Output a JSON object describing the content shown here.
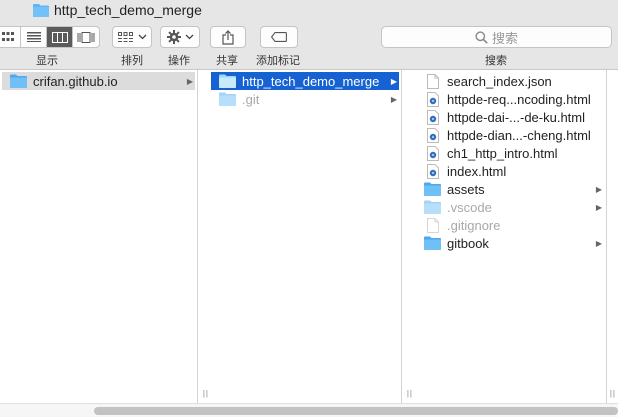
{
  "window": {
    "title": "http_tech_demo_merge"
  },
  "toolbar": {
    "view_label": "显示",
    "arrange_label": "排列",
    "action_label": "操作",
    "share_label": "共享",
    "tags_label": "添加标记",
    "search_placeholder": "搜索",
    "search_label": "搜索"
  },
  "columns": [
    {
      "items": [
        {
          "name": "crifan.github.io",
          "type": "folder",
          "selected": "inactive",
          "has_children": true
        }
      ]
    },
    {
      "items": [
        {
          "name": "http_tech_demo_merge",
          "type": "folder",
          "selected": "active",
          "has_children": true
        },
        {
          "name": ".git",
          "type": "folder",
          "dim": true,
          "has_children": true
        }
      ]
    },
    {
      "items": [
        {
          "name": "search_index.json",
          "type": "file"
        },
        {
          "name": "httpde-req...ncoding.html",
          "type": "html"
        },
        {
          "name": "httpde-dai-...-de-ku.html",
          "type": "html"
        },
        {
          "name": "httpde-dian...-cheng.html",
          "type": "html"
        },
        {
          "name": "ch1_http_intro.html",
          "type": "html"
        },
        {
          "name": "index.html",
          "type": "html"
        },
        {
          "name": "assets",
          "type": "folder",
          "has_children": true
        },
        {
          "name": ".vscode",
          "type": "folder",
          "dim": true,
          "has_children": true
        },
        {
          "name": ".gitignore",
          "type": "file",
          "dim": true
        },
        {
          "name": "gitbook",
          "type": "folder",
          "has_children": true
        }
      ]
    }
  ],
  "colors": {
    "selection": "#1662d3",
    "folder": "#5fb6f5"
  }
}
